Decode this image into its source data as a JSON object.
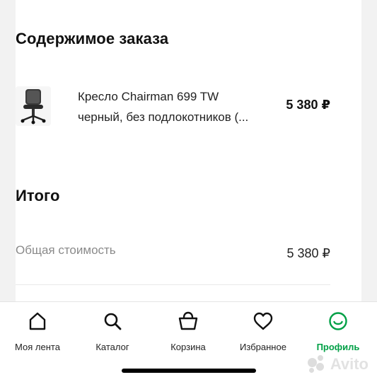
{
  "order": {
    "title": "Содержимое заказа",
    "item": {
      "name_line1": "Кресло Chairman 699 TW",
      "name_line2": "черный, без подлокотников (...",
      "price": "5 380 ₽",
      "image_icon": "office-chair-icon"
    }
  },
  "total": {
    "title": "Итого",
    "label": "Общая стоимость",
    "value": "5 380 ₽"
  },
  "tabbar": {
    "items": [
      {
        "label": "Моя лента",
        "icon": "home-icon",
        "active": false
      },
      {
        "label": "Каталог",
        "icon": "search-icon",
        "active": false
      },
      {
        "label": "Корзина",
        "icon": "basket-icon",
        "active": false
      },
      {
        "label": "Избранное",
        "icon": "heart-icon",
        "active": false
      },
      {
        "label": "Профиль",
        "icon": "profile-smile-icon",
        "active": true
      }
    ],
    "active_color": "#00a046"
  },
  "watermark": {
    "text": "Avito"
  }
}
